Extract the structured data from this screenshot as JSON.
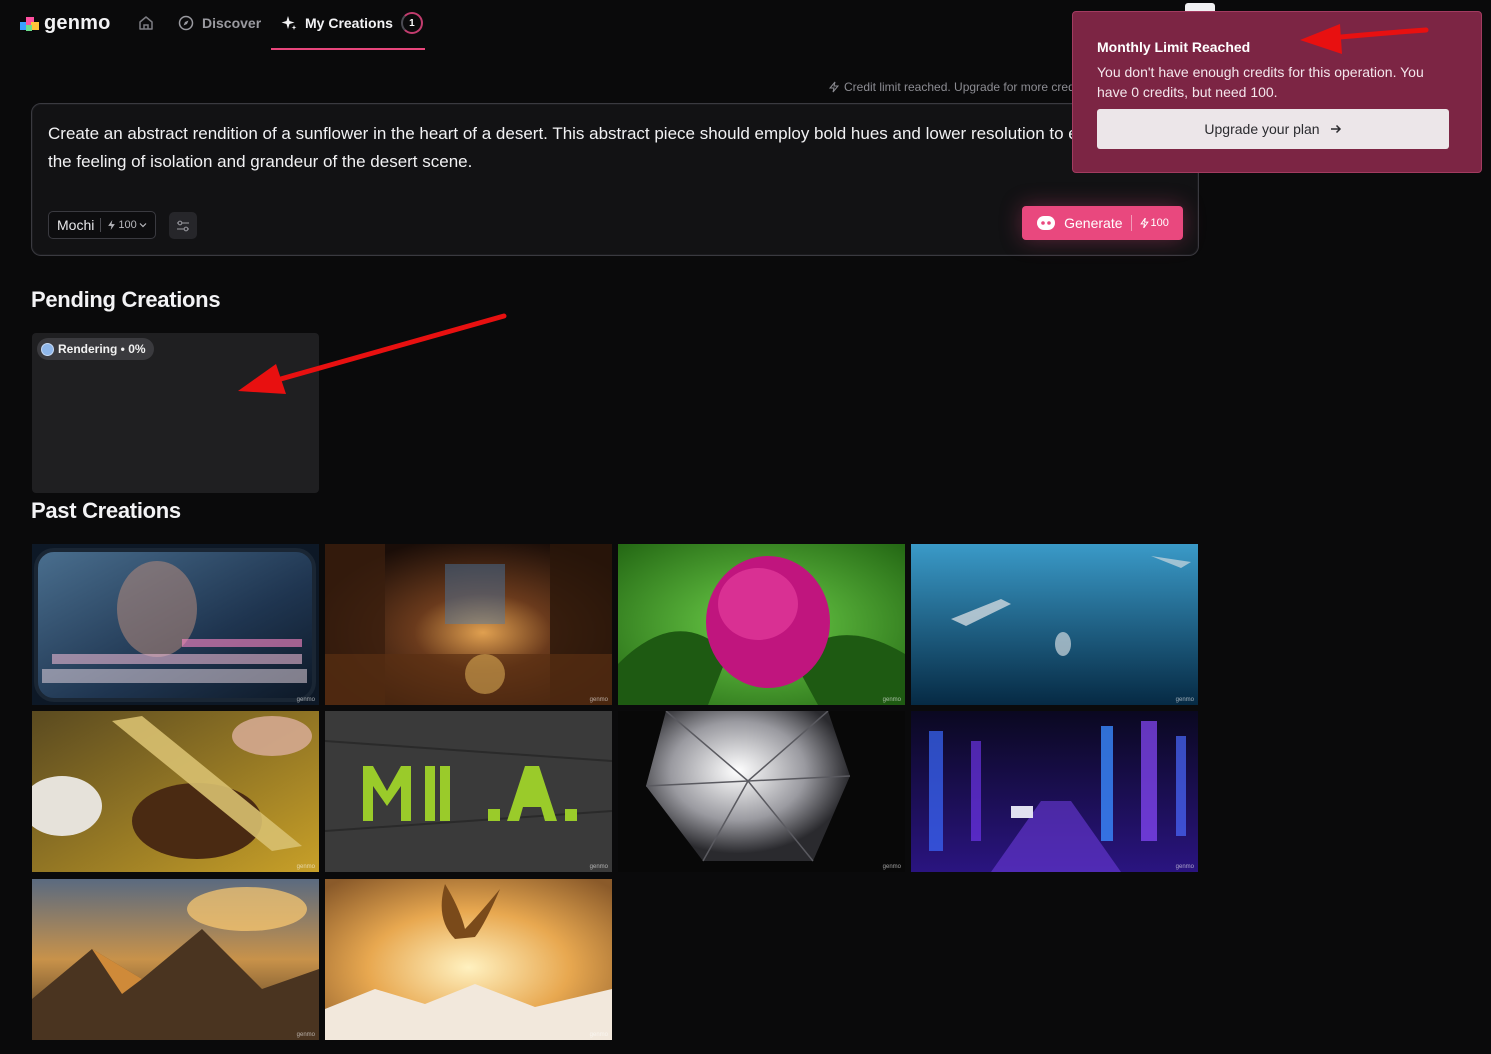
{
  "nav": {
    "logo_text": "genmo",
    "discover_label": "Discover",
    "creations_label": "My Creations",
    "creations_count": "1"
  },
  "credit_notice": "Credit limit reached. Upgrade for more cred",
  "prompt": {
    "text": "Create an abstract rendition of a sunflower in the heart of a desert. This abstract piece should employ bold hues and lower resolution to emphasize the feeling of isolation and grandeur of the desert scene.",
    "model": "Mochi",
    "model_cost": "100",
    "generate_label": "Generate",
    "generate_cost": "100"
  },
  "pending": {
    "title": "Pending Creations",
    "status": "Rendering • 0%"
  },
  "past": {
    "title": "Past Creations",
    "watermark": "genmo",
    "items": [
      {
        "name": "train-window-woman"
      },
      {
        "name": "underground-city"
      },
      {
        "name": "pink-peony-bud"
      },
      {
        "name": "underwater-swimmers"
      },
      {
        "name": "knife-cutting-meat"
      },
      {
        "name": "moss-letters-slate"
      },
      {
        "name": "diamond-closeup"
      },
      {
        "name": "neon-city-street"
      },
      {
        "name": "mountain-sunset"
      },
      {
        "name": "eagle-over-mountains"
      }
    ]
  },
  "toast": {
    "title": "Monthly Limit Reached",
    "body": "You don't have enough credits for this operation. You have 0 credits, but need 100.",
    "button_label": "Upgrade your plan"
  },
  "colors": {
    "accent": "#e9487e",
    "toast_bg": "#7c2544",
    "background": "#0a0a0b"
  }
}
